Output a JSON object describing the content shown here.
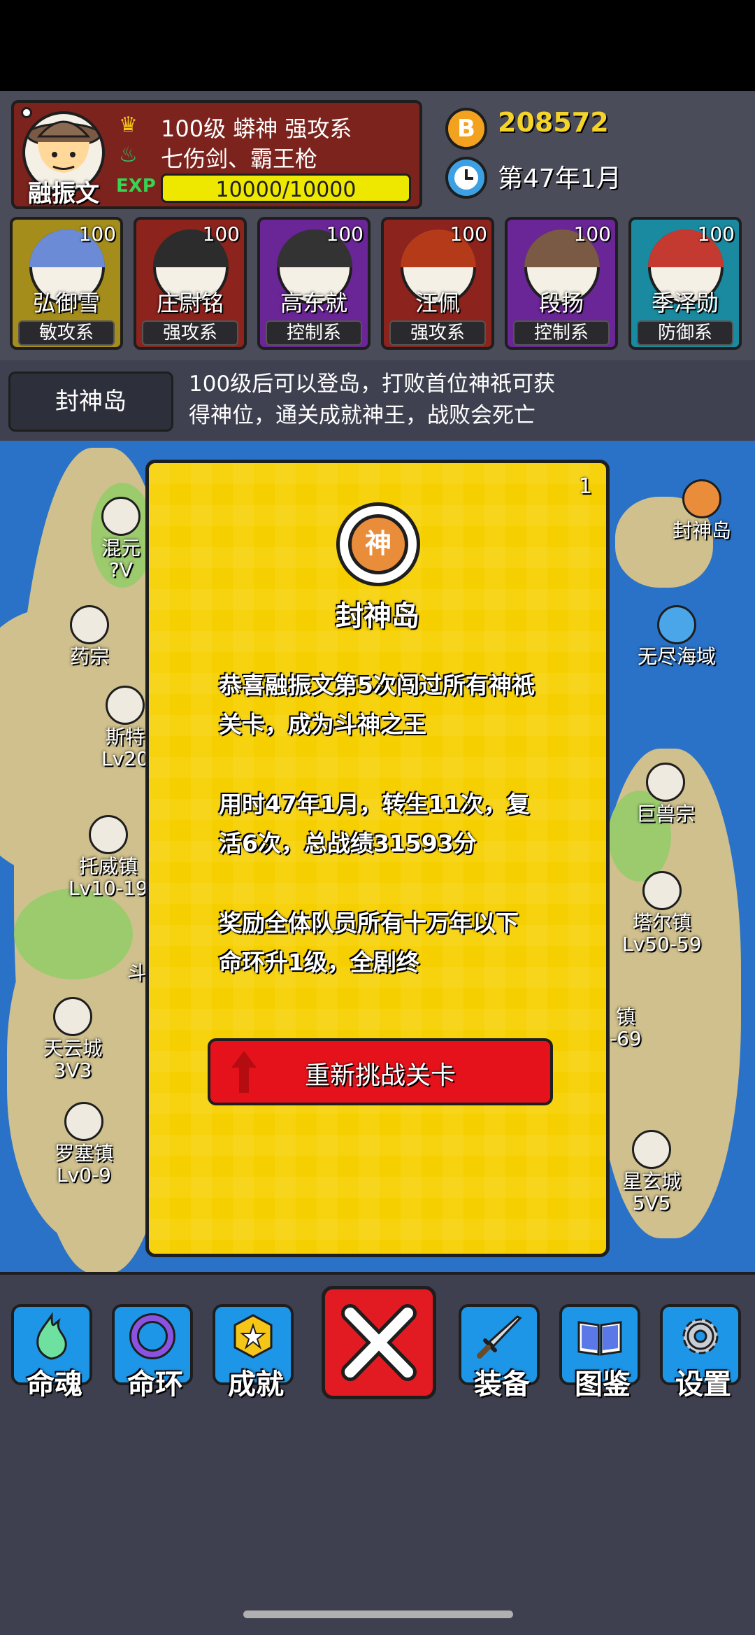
{
  "player": {
    "name": "融振文",
    "level_line": "100级 蟒神 强攻系",
    "weapons": "七伤剑、霸王枪",
    "xp_label": "EXP",
    "xp_text": "10000/10000",
    "xp_fraction": 1.0
  },
  "resources": {
    "coin_icon_letter": "B",
    "coins": "208572",
    "date": "第47年1月"
  },
  "team": [
    {
      "name": "弘御雪",
      "level": "100",
      "type": "敏攻系",
      "card_color": "#a58d1c",
      "hair_color": "#6b8bd6"
    },
    {
      "name": "庄尉铭",
      "level": "100",
      "type": "强攻系",
      "card_color": "#8c231c",
      "hair_color": "#2c2c2c"
    },
    {
      "name": "高东就",
      "level": "100",
      "type": "控制系",
      "card_color": "#6a2596",
      "hair_color": "#333333"
    },
    {
      "name": "汪佩",
      "level": "100",
      "type": "强攻系",
      "card_color": "#8c231c",
      "hair_color": "#b53a1a"
    },
    {
      "name": "段扬",
      "level": "100",
      "type": "控制系",
      "card_color": "#6a2596",
      "hair_color": "#7a5a44"
    },
    {
      "name": "季泽勋",
      "level": "100",
      "type": "防御系",
      "card_color": "#1a8aa0",
      "hair_color": "#c43a30"
    }
  ],
  "info": {
    "island_button": "封神岛",
    "description_line1": "100级后可以登岛，打败首位神祇可获",
    "description_line2": "得神位，通关成就神王，战败会死亡"
  },
  "map_locations": {
    "hunyuan": "混元",
    "hunyuan_lv": "?V",
    "yaozong": "药宗",
    "site": "斯特",
    "site_lv": "Lv20",
    "tuowei": "托威镇",
    "tuowei_lv": "Lv10-19",
    "dou": "斗",
    "tianyun": "天云城",
    "tianyun_lv": "3V3",
    "luosai": "罗塞镇",
    "luosai_lv": "Lv0-9",
    "fengshen": "封神岛",
    "wujin": "无尽海域",
    "jushou": "巨兽宗",
    "taer": "塔尔镇",
    "taer_lv": "Lv50-59",
    "zhen": "镇",
    "zhen_lv": "-69",
    "xingxuan": "星玄城",
    "xingxuan_lv": "5V5"
  },
  "dialog": {
    "number": "1",
    "emblem_char": "神",
    "title": "封神岛",
    "para1_line1": "恭喜融振文第5次闯过所有神祇",
    "para1_line2": "关卡，成为斗神之王",
    "para2_line1": "用时47年1月，转生11次，复",
    "para2_line2": "活6次，总战绩31593分",
    "para3_line1": "奖励全体队员所有十万年以下",
    "para3_line2": "命环升1级，全剧终",
    "retry_button": "重新挑战关卡"
  },
  "bottom_nav": {
    "soul": "命魂",
    "ring": "命环",
    "achievement": "成就",
    "equipment": "装备",
    "codex": "图鉴",
    "settings": "设置"
  }
}
